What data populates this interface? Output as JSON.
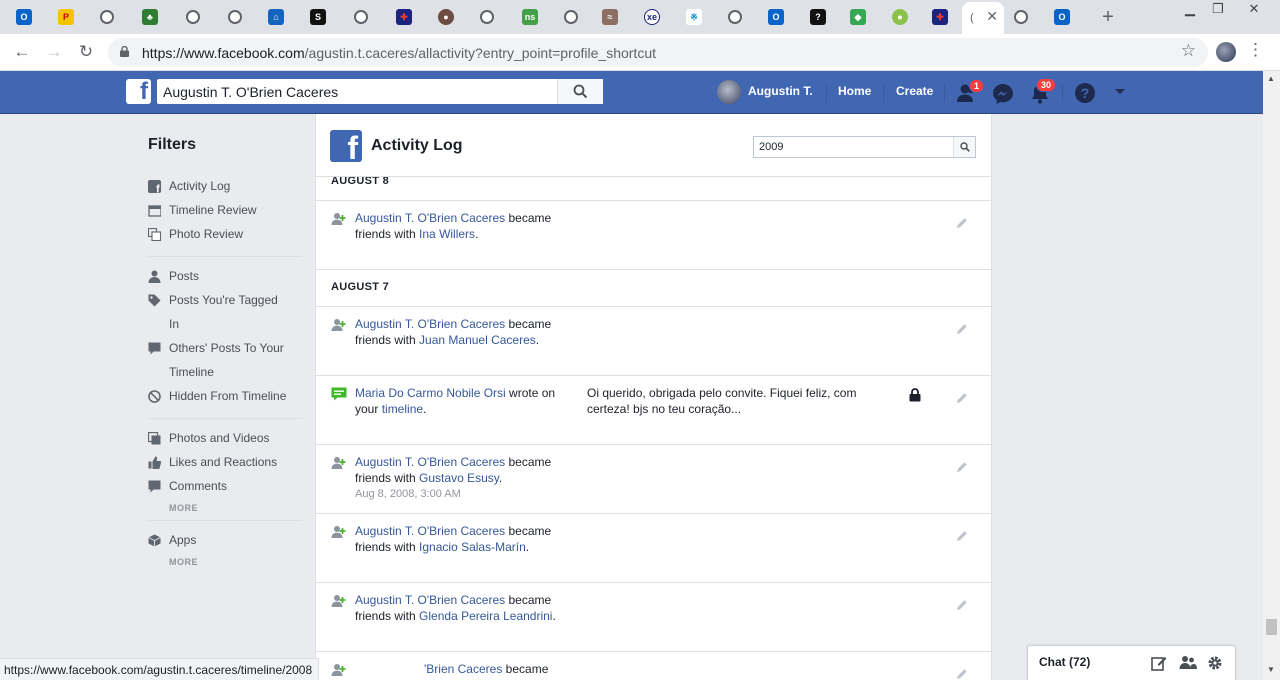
{
  "browser": {
    "active_tab_label": "(",
    "url_host": "https://www.facebook.com",
    "url_path": "/agustin.t.caceres/allactivity?entry_point=profile_shortcut",
    "status_url": "https://www.facebook.com/agustin.t.caceres/timeline/2008"
  },
  "fb": {
    "search_value": "Augustin T. O'Brien Caceres",
    "profile_name": "Augustin T.",
    "nav_home": "Home",
    "nav_create": "Create",
    "friend_requests_badge": "1",
    "notifications_badge": "30"
  },
  "sidebar": {
    "title": "Filters",
    "groups": [
      [
        "Activity Log",
        "Timeline Review",
        "Photo Review"
      ],
      [
        "Posts",
        "Posts You're Tagged",
        "In",
        "Others' Posts To Your",
        "Timeline",
        "Hidden From Timeline"
      ],
      [
        "Photos and Videos",
        "Likes and Reactions",
        "Comments"
      ],
      [
        "Apps"
      ]
    ],
    "more": "MORE"
  },
  "panel": {
    "title": "Activity Log",
    "year_value": "2009"
  },
  "log": {
    "date1": "AUGUST 8",
    "date2": "AUGUST 7",
    "actor": "Augustin T. O'Brien Caceres",
    "verb_became": "became",
    "verb_friends_with": "friends with",
    "entries": [
      {
        "friend": "Ina Willers"
      },
      {
        "friend": "Juan Manuel Caceres"
      },
      {
        "author": "Maria Do Carmo Nobile Orsi",
        "verb": "wrote on",
        "pre": "your",
        "link": "timeline",
        "message": "Oi querido, obrigada pelo convite. Fiquei feliz, com certeza! bjs no teu coração..."
      },
      {
        "friend": "Gustavo Esusy",
        "time": "Aug 8, 2008, 3:00 AM"
      },
      {
        "friend": "Ignacio Salas-Marín"
      },
      {
        "friend": "Glenda Pereira Leandrini"
      },
      {
        "partial_actor": "'Brien Caceres"
      }
    ]
  },
  "chat": {
    "label": "Chat (72)"
  }
}
